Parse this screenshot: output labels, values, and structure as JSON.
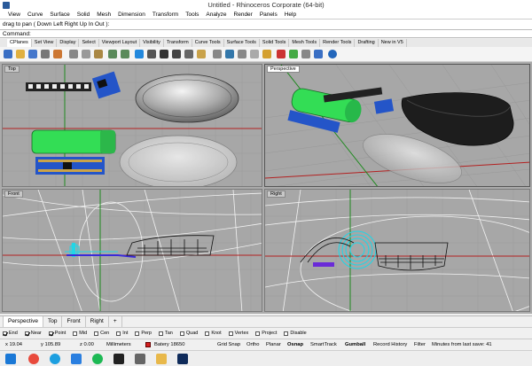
{
  "window": {
    "title": "Untitled - Rhinoceros Corporate (64-bit)"
  },
  "menu": [
    "View",
    "Curve",
    "Surface",
    "Solid",
    "Mesh",
    "Dimension",
    "Transform",
    "Tools",
    "Analyze",
    "Render",
    "Panels",
    "Help"
  ],
  "command": {
    "history": "drag to pan ( Down  Left  Right  Up  In  Out ):",
    "prompt": "Command:"
  },
  "toolbar_tabs": [
    "CPlanes",
    "Set View",
    "Display",
    "Select",
    "Viewport Layout",
    "Visibility",
    "Transform",
    "Curve Tools",
    "Surface Tools",
    "Solid Tools",
    "Mesh Tools",
    "Render Tools",
    "Drafting",
    "New in V5"
  ],
  "viewports": {
    "top": "Top",
    "perspective": "Perspective",
    "front": "Front",
    "right": "Right"
  },
  "viewport_tabs": [
    "Perspective",
    "Top",
    "Front",
    "Right",
    "+"
  ],
  "active_viewport_tab": "Perspective",
  "osnaps": [
    {
      "label": "End",
      "checked": true
    },
    {
      "label": "Near",
      "checked": true
    },
    {
      "label": "Point",
      "checked": true
    },
    {
      "label": "Mid",
      "checked": false
    },
    {
      "label": "Cen",
      "checked": false
    },
    {
      "label": "Int",
      "checked": false
    },
    {
      "label": "Perp",
      "checked": false
    },
    {
      "label": "Tan",
      "checked": false
    },
    {
      "label": "Quad",
      "checked": false
    },
    {
      "label": "Knot",
      "checked": false
    },
    {
      "label": "Vertex",
      "checked": false
    },
    {
      "label": "Project",
      "checked": false
    },
    {
      "label": "Disable",
      "checked": false
    }
  ],
  "status": {
    "x": "x 19.04",
    "y": "y 105.89",
    "z": "z 0.00",
    "units": "Millimeters",
    "layer": "Batery 18650",
    "layer_color": "#d31e1e",
    "grid_snap": "Grid Snap",
    "ortho": "Ortho",
    "planar": "Planar",
    "osnap": "Osnap",
    "smarttrack": "SmartTrack",
    "gumball": "Gumball",
    "record_history": "Record History",
    "filter": "Filter",
    "autosave": "Minutes from last save: 41"
  },
  "colors": {
    "viewport_bg": "#a7a7a7",
    "x_axis": "#b32020",
    "y_axis": "#1f8a1f",
    "battery": "#33dd55",
    "board": "#2455c8",
    "selected": "#22d6e6"
  },
  "taskbar_icons": [
    "start-icon",
    "chrome-icon",
    "skype-icon",
    "dropbox-icon",
    "spotify-icon",
    "app-icon",
    "rhino-icon",
    "explorer-icon",
    "photoshop-icon"
  ]
}
